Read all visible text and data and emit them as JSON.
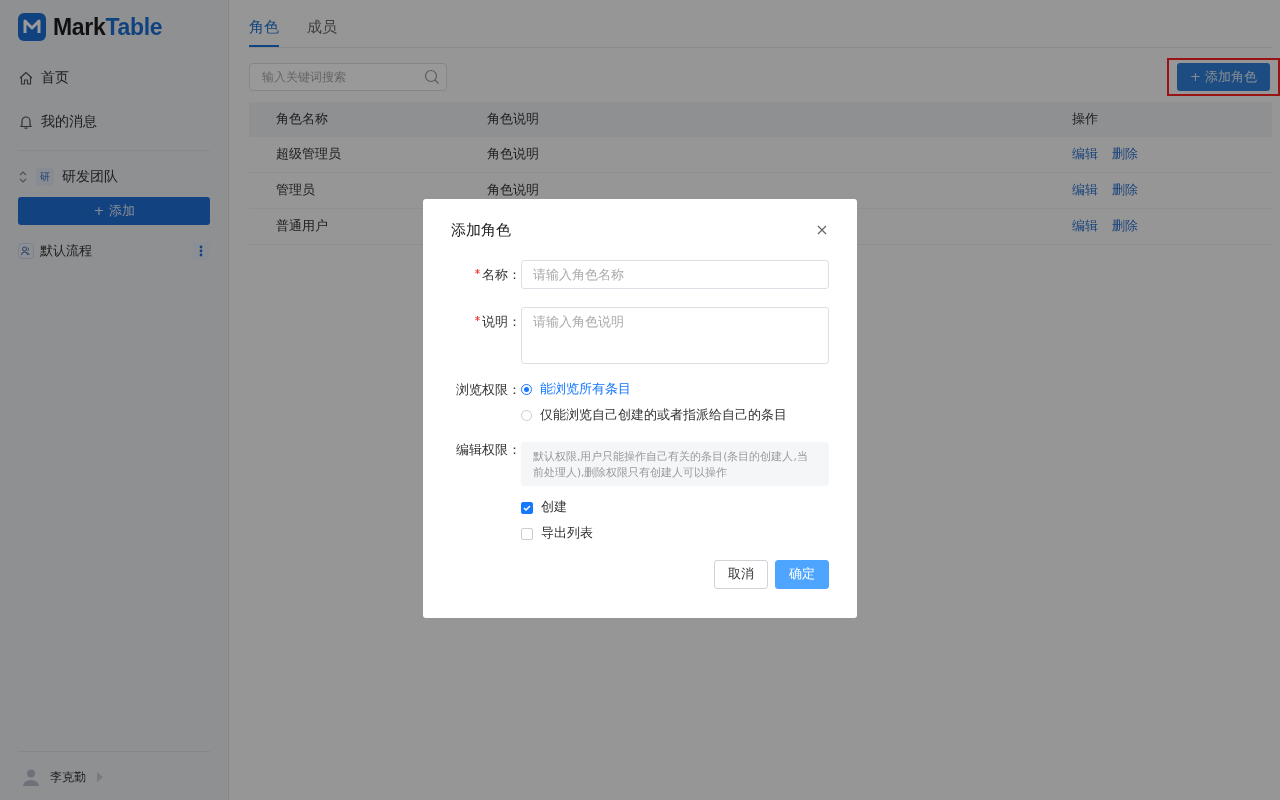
{
  "brand": {
    "name": "Mark",
    "name_accent": "Table"
  },
  "sidebar": {
    "nav": [
      {
        "label": "首页",
        "kind": "home"
      },
      {
        "label": "我的消息",
        "kind": "bell"
      }
    ],
    "team": {
      "badge": "研",
      "name": "研发团队"
    },
    "add_button": "+ 添加",
    "workflows": [
      {
        "label": "默认流程"
      }
    ],
    "user": {
      "name": "李克勤"
    }
  },
  "tabs": [
    {
      "label": "角色",
      "selected": true
    },
    {
      "label": "成员",
      "selected": false
    }
  ],
  "search": {
    "placeholder": "输入关键词搜索"
  },
  "add_role_button": {
    "label": "+ 添加角色",
    "highlighted": true
  },
  "table": {
    "columns": [
      "角色名称",
      "角色说明",
      "操作"
    ],
    "rows": [
      {
        "name": "超级管理员",
        "description": "角色说明",
        "actions": [
          "编辑",
          "删除"
        ]
      },
      {
        "name": "管理员",
        "description": "角色说明",
        "actions": [
          "编辑",
          "删除"
        ]
      },
      {
        "name": "普通用户",
        "actions": [
          "编辑",
          "删除"
        ]
      }
    ]
  },
  "dialog": {
    "title": "添加角色",
    "fields": [
      {
        "label": "名称：",
        "required": true,
        "kind": "input",
        "placeholder": "请输入角色名称"
      },
      {
        "label": "说明：",
        "required": true,
        "kind": "textarea",
        "placeholder": "请输入角色说明"
      }
    ],
    "view_permission": {
      "label": "浏览权限：",
      "options": [
        {
          "label": "能浏览所有条目",
          "selected": true
        },
        {
          "label": "仅能浏览自己创建的或者指派给自己的条目",
          "selected": false
        }
      ]
    },
    "edit_permission": {
      "label": "编辑权限：",
      "note": "默认权限,用户只能操作自己有关的条目(条目的创建人,当前处理人),删除权限只有创建人可以操作",
      "options": [
        {
          "label": "创建",
          "checked": true
        },
        {
          "label": "导出列表",
          "checked": false
        }
      ]
    },
    "buttons": [
      {
        "label": "取消",
        "kind": "default"
      },
      {
        "label": "确定",
        "kind": "primary"
      }
    ]
  }
}
